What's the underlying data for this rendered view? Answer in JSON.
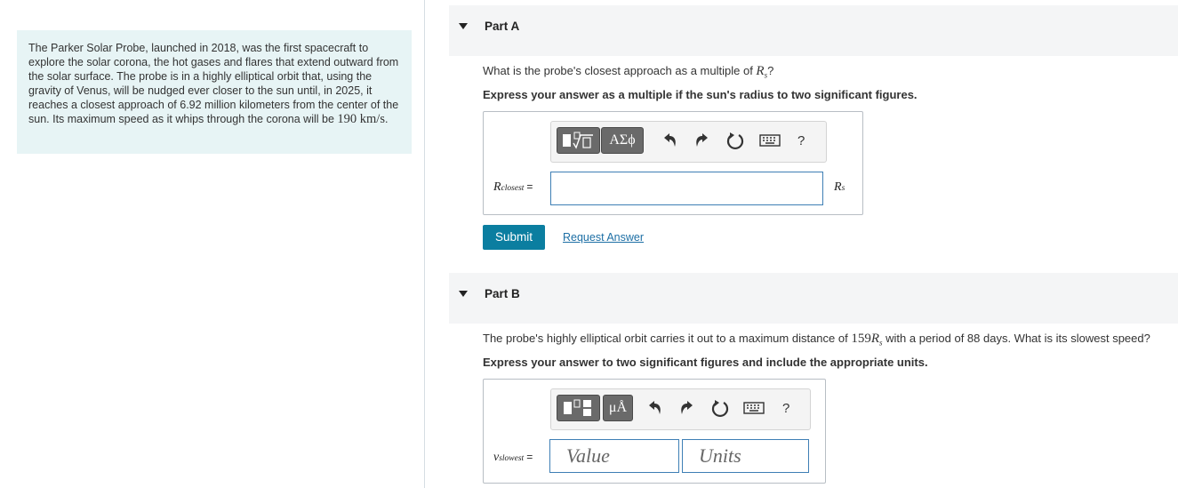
{
  "problem": {
    "text": "The Parker Solar Probe, launched in 2018, was the first spacecraft to explore the solar corona, the hot gases and flares that extend outward from the solar surface. The probe is in a highly elliptical orbit that, using the gravity of Venus, will be nudged ever closer to the sun until, in 2025, it reaches a closest approach of 6.92 million kilometers from the center of the sun. Its maximum speed as it whips through the corona will be",
    "speed_value": "190",
    "speed_unit": "km/s",
    "end_punct": "."
  },
  "partA": {
    "title": "Part A",
    "question_pre": "What is the probe's closest approach as a multiple of ",
    "question_sym": "R",
    "question_sub": "s",
    "question_post": "?",
    "instruction": "Express your answer as a multiple if the sun's radius to two significant figures.",
    "toolbar": {
      "templates_icon": "templates-icon",
      "greek_label": "ΑΣϕ",
      "undo_icon": "undo-icon",
      "redo_icon": "redo-icon",
      "reset_icon": "reset-icon",
      "keyboard_icon": "keyboard-icon",
      "help_label": "?"
    },
    "var_sym": "R",
    "var_sub": "closest",
    "equals": "=",
    "answer_value": "",
    "unit_sym": "R",
    "unit_sub": "s",
    "submit_label": "Submit",
    "request_label": "Request Answer"
  },
  "partB": {
    "title": "Part B",
    "question_pre": "The probe's highly elliptical orbit carries it out to a maximum distance of ",
    "question_num": "159",
    "question_sym": "R",
    "question_sub": "s",
    "question_post": " with a period of 88 days. What is its slowest speed?",
    "instruction": "Express your answer to two significant figures and include the appropriate units.",
    "toolbar": {
      "templates_icon": "templates-icon",
      "units_label": "μÅ",
      "undo_icon": "undo-icon",
      "redo_icon": "redo-icon",
      "reset_icon": "reset-icon",
      "keyboard_icon": "keyboard-icon",
      "help_label": "?"
    },
    "var_sym": "v",
    "var_sub": "slowest",
    "equals": "=",
    "value_placeholder": "Value",
    "units_placeholder": "Units"
  },
  "colors": {
    "problem_bg": "#e7f4f5",
    "part_header_bg": "#f4f5f6",
    "submit_bg": "#0b7ea0",
    "link": "#1d6fa5",
    "input_border": "#3e7fb5"
  }
}
